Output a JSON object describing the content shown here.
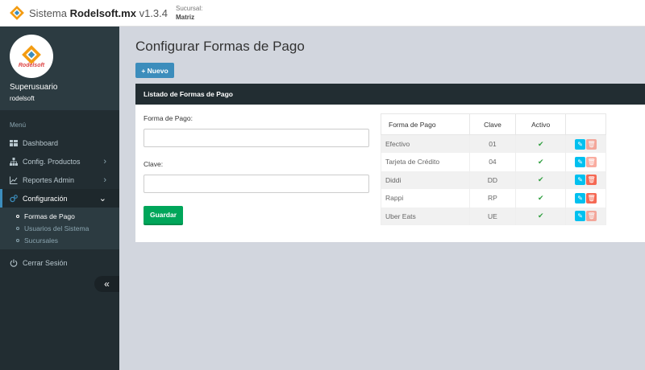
{
  "topbar": {
    "brand_prefix": "Sistema",
    "brand_bold": "Rodelsoft.mx",
    "version": "v1.3.4",
    "sucursal_label": "Sucursal:",
    "sucursal_value": "Matriz"
  },
  "sidebar": {
    "logo_text": "Rodelsoft",
    "user_name": "Superusuario",
    "user_login": "rodelsoft",
    "menu_header": "Menú",
    "items": [
      {
        "label": "Dashboard",
        "icon": "dashboard-icon"
      },
      {
        "label": "Config. Productos",
        "icon": "sitemap-icon"
      },
      {
        "label": "Reportes Admin",
        "icon": "chart-line-icon"
      },
      {
        "label": "Configuración",
        "icon": "cogs-icon",
        "active": true
      }
    ],
    "subitems": [
      {
        "label": "Formas de Pago",
        "active": true
      },
      {
        "label": "Usuarios del Sistema"
      },
      {
        "label": "Sucursales"
      }
    ],
    "logout": "Cerrar Sesión",
    "collapse_icon": "«"
  },
  "main": {
    "title": "Configurar Formas de Pago",
    "new_button": "+ Nuevo",
    "box_title": "Listado de Formas de Pago",
    "form": {
      "forma_label": "Forma de Pago:",
      "forma_value": "",
      "clave_label": "Clave:",
      "clave_value": "",
      "save_button": "Guardar"
    },
    "table": {
      "columns": [
        "Forma de Pago",
        "Clave",
        "Activo",
        ""
      ],
      "rows": [
        {
          "name": "Efectivo",
          "key": "01",
          "active": "✔"
        },
        {
          "name": "Tarjeta de Crédito",
          "key": "04",
          "active": "✔"
        },
        {
          "name": "Diddi",
          "key": "DD",
          "active": "✔"
        },
        {
          "name": "Rappi",
          "key": "RP",
          "active": "✔"
        },
        {
          "name": "Uber Eats",
          "key": "UE",
          "active": "✔"
        }
      ]
    }
  },
  "colors": {
    "primary": "#3c8dbc",
    "success": "#00a65a",
    "sidebar_bg": "#222d32",
    "edit": "#00c0ef",
    "delete": "#f56954"
  }
}
